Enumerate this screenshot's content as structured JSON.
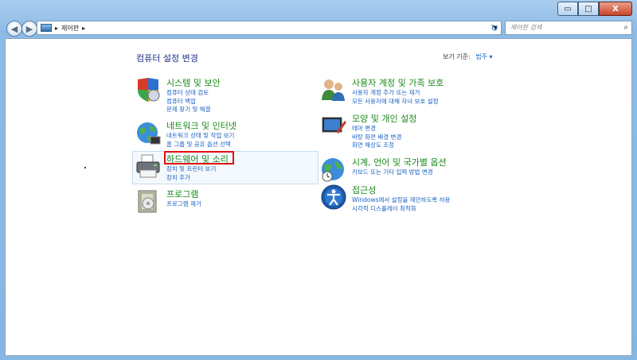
{
  "window": {
    "minimize": "▭",
    "maximize": "□",
    "close": "X"
  },
  "toolbar": {
    "address_separator": "▸",
    "address_path": "제어판",
    "address_arrow": "▸",
    "search_placeholder": "제어판 검색"
  },
  "page": {
    "title": "컴퓨터 설정 변경",
    "view_by_label": "보기 기준:",
    "view_by_value": "범주 ▾"
  },
  "categories": [
    {
      "title": "시스템 및 보안",
      "links": [
        "컴퓨터 상태 검토",
        "컴퓨터 백업",
        "문제 찾기 및 해결"
      ]
    },
    {
      "title": "네트워크 및 인터넷",
      "links": [
        "네트워크 상태 및 작업 보기",
        "홈 그룹 및 공유 옵션 선택"
      ]
    },
    {
      "title": "하드웨어 및 소리",
      "links": [
        "장치 및 프린터 보기",
        "장치 추가"
      ]
    },
    {
      "title": "프로그램",
      "links": [
        "프로그램 제거"
      ]
    },
    {
      "title": "사용자 계정 및 가족 보호",
      "links": [
        "사용자 계정 추가 또는 제거",
        "모든 사용자에 대해 자녀 보호 설정"
      ]
    },
    {
      "title": "모양 및 개인 설정",
      "links": [
        "테마 변경",
        "바탕 화면 배경 변경",
        "화면 해상도 조정"
      ]
    },
    {
      "title": "시계, 언어 및 국가별 옵션",
      "links": [
        "키보드 또는 기타 입력 방법 변경"
      ]
    },
    {
      "title": "접근성",
      "links": [
        "Windows에서 설정을 제안하도록 허용",
        "시각적 디스플레이 최적화"
      ]
    }
  ],
  "colors": {
    "category_title": "#1a8a1a",
    "link": "#1a62c4",
    "page_title": "#1e3287",
    "highlight_box": "#e01010"
  }
}
